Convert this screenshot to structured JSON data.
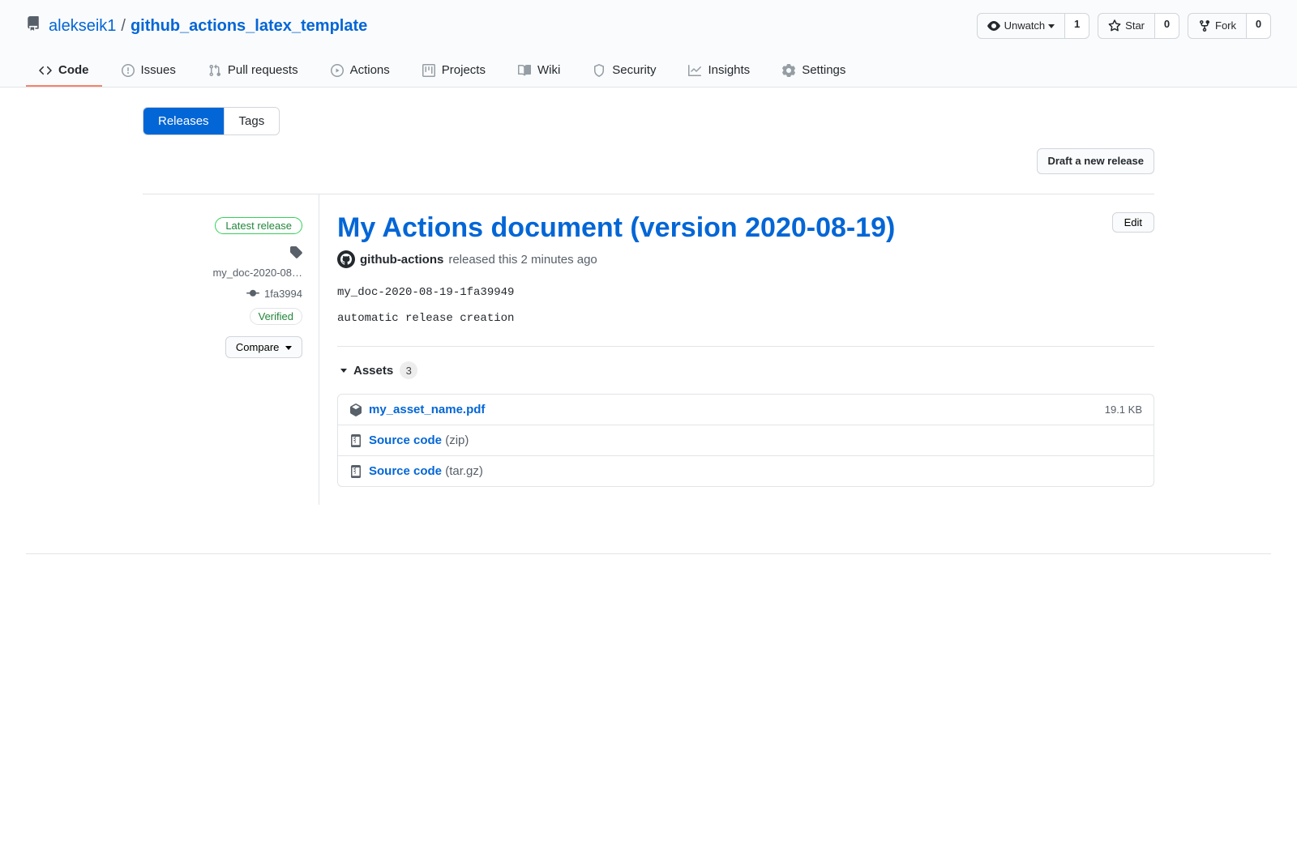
{
  "repo": {
    "owner": "alekseik1",
    "name": "github_actions_latex_template"
  },
  "actions": {
    "watch": {
      "label": "Unwatch",
      "count": "1"
    },
    "star": {
      "label": "Star",
      "count": "0"
    },
    "fork": {
      "label": "Fork",
      "count": "0"
    }
  },
  "nav": {
    "code": "Code",
    "issues": "Issues",
    "pulls": "Pull requests",
    "actions": "Actions",
    "projects": "Projects",
    "wiki": "Wiki",
    "security": "Security",
    "insights": "Insights",
    "settings": "Settings"
  },
  "subnav": {
    "releases": "Releases",
    "tags": "Tags",
    "draft_button": "Draft a new release"
  },
  "sidebar": {
    "latest_label": "Latest release",
    "tag": "my_doc-2020-08…",
    "commit": "1fa3994",
    "verified": "Verified",
    "compare": "Compare"
  },
  "release": {
    "title": "My Actions document (version 2020-08-19)",
    "edit": "Edit",
    "author": "github-actions",
    "released_text": "released this 2 minutes ago",
    "body_line1": "my_doc-2020-08-19-1fa39949",
    "body_line2": "automatic release creation",
    "assets_label": "Assets",
    "assets_count": "3",
    "assets": [
      {
        "name": "my_asset_name.pdf",
        "ext": "",
        "size": "19.1 KB",
        "icon": "package"
      },
      {
        "name": "Source code",
        "ext": "(zip)",
        "size": "",
        "icon": "zip"
      },
      {
        "name": "Source code",
        "ext": "(tar.gz)",
        "size": "",
        "icon": "zip"
      }
    ]
  }
}
